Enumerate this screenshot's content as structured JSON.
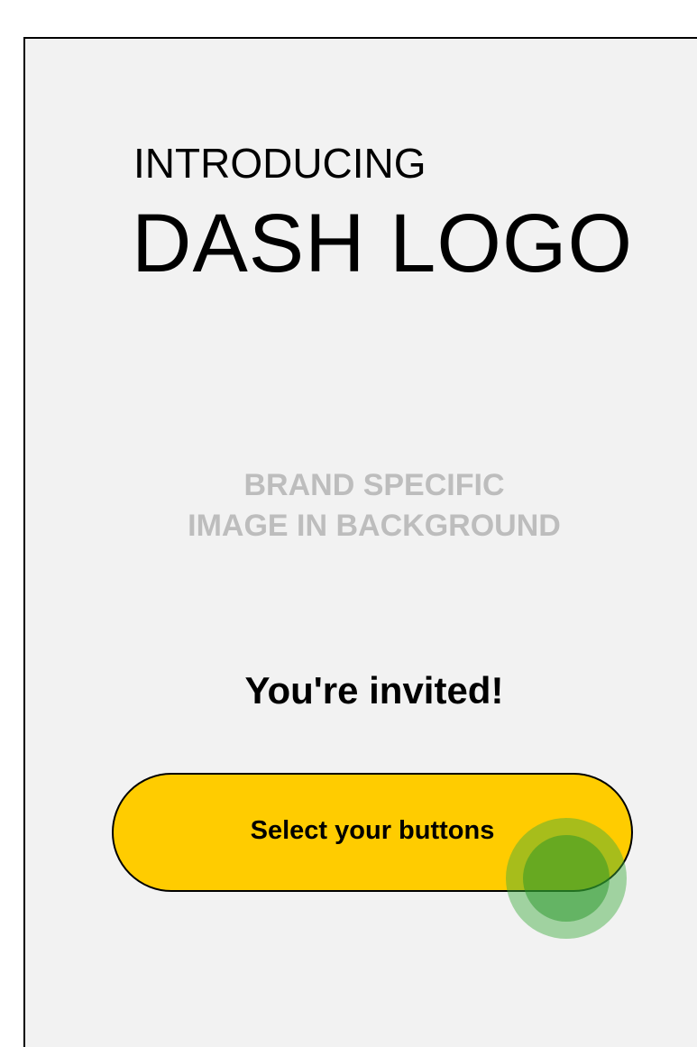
{
  "header": {
    "eyebrow": "INTRODUCING",
    "brand": "DASH LOGO"
  },
  "background": {
    "placeholder_line1": "BRAND SPECIFIC",
    "placeholder_line2": "IMAGE IN BACKGROUND"
  },
  "invite": {
    "message": "You're invited!"
  },
  "cta": {
    "label": "Select your buttons"
  },
  "colors": {
    "screen_bg": "#f2f2f2",
    "button_fill": "#ffcc00",
    "placeholder_text": "#bdbdbd",
    "touch_indicator": "#3cb043"
  },
  "icons": {
    "touch_indicator": "tap-indicator-icon"
  }
}
